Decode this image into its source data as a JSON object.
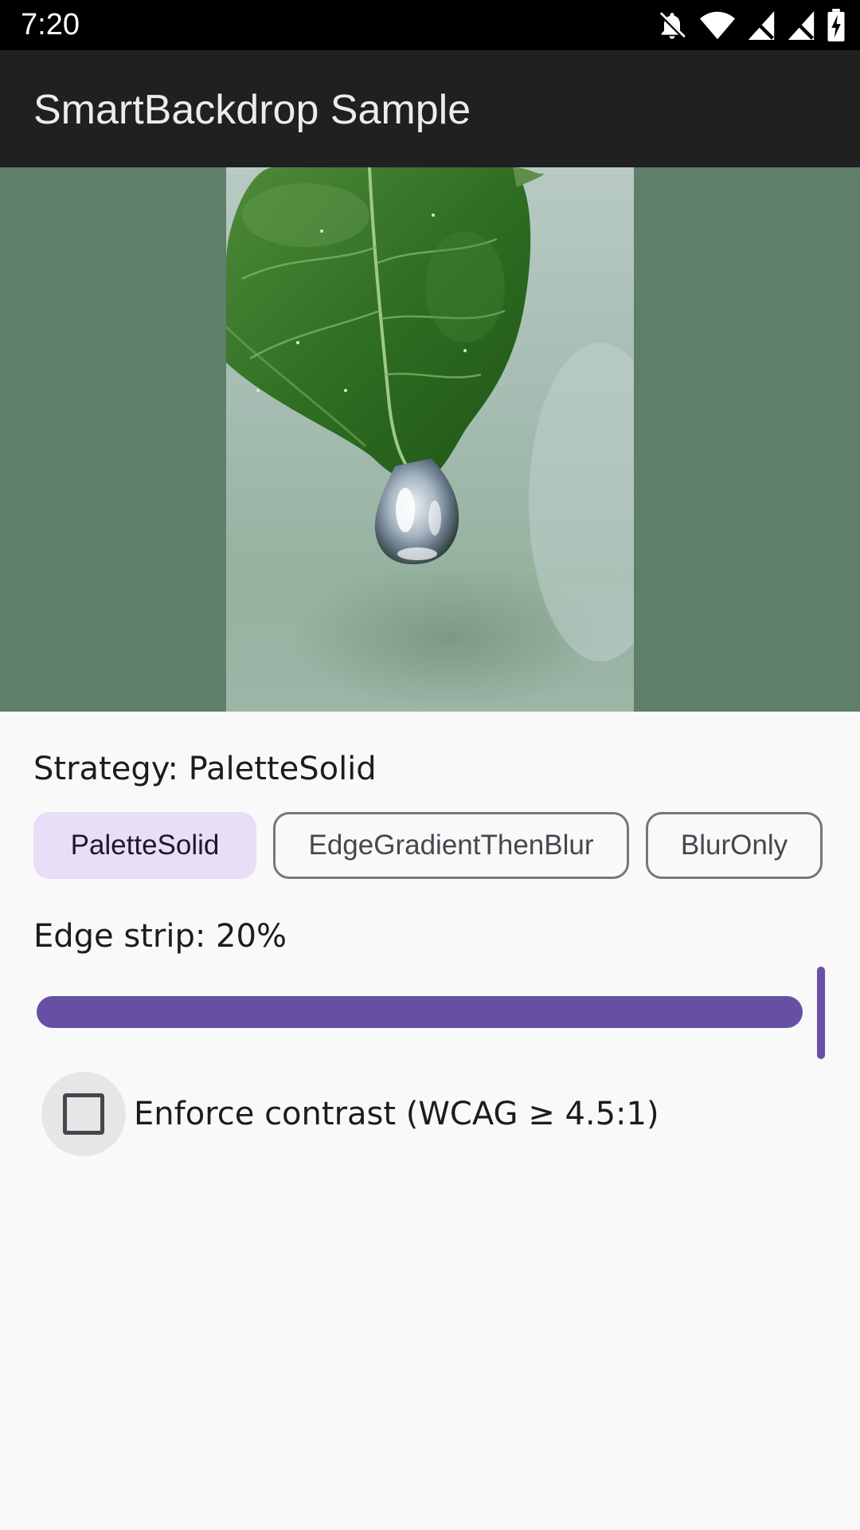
{
  "status_bar": {
    "time": "7:20",
    "icons": [
      "notifications-off-icon",
      "wifi-icon",
      "signal-off-icon",
      "signal-off-icon",
      "battery-charging-icon"
    ]
  },
  "app_bar": {
    "title": "SmartBackdrop Sample"
  },
  "preview": {
    "backdrop_color": "#5f7f6b",
    "image_subject": "leaf-with-water-drop"
  },
  "controls": {
    "strategy_label": "Strategy: PaletteSolid",
    "chips": [
      {
        "label": "PaletteSolid",
        "selected": true
      },
      {
        "label": "EdgeGradientThenBlur",
        "selected": false
      },
      {
        "label": "BlurOnly",
        "selected": false
      }
    ],
    "edge_strip_label": "Edge strip: 20%",
    "edge_strip": {
      "value": 20,
      "slider_fraction": 1.0
    },
    "contrast": {
      "label": "Enforce contrast (WCAG ≥ 4.5:1)",
      "checked": false
    }
  },
  "colors": {
    "accent": "#6750a4",
    "chip_selected_bg": "#e8def8",
    "app_bar_bg": "#202020"
  }
}
